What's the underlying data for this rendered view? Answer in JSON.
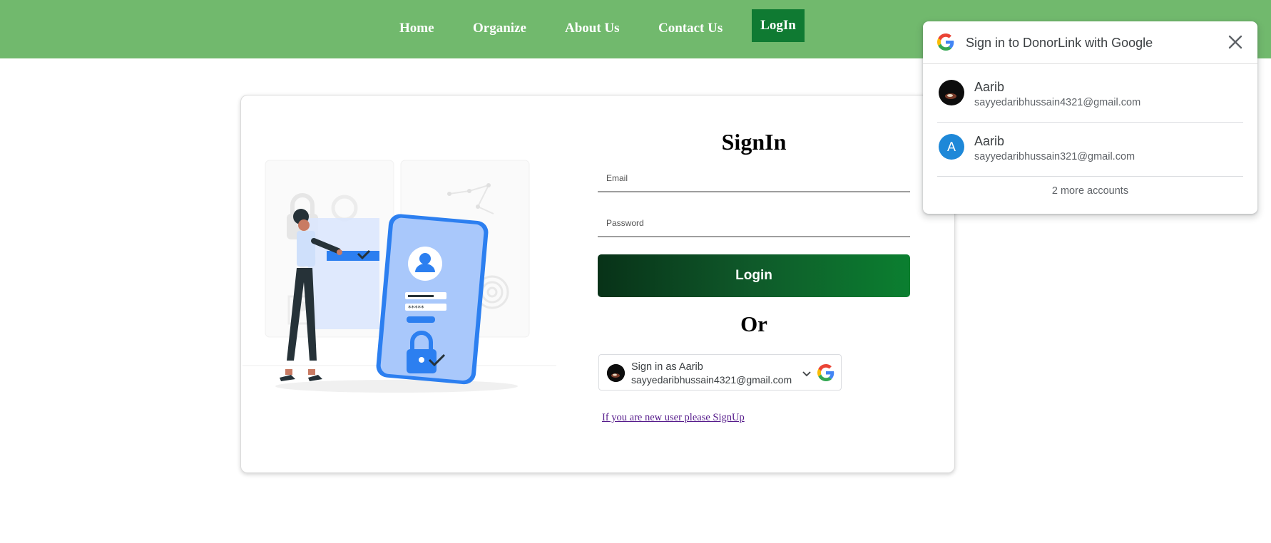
{
  "navbar": {
    "items": [
      {
        "label": "Home"
      },
      {
        "label": "Organize"
      },
      {
        "label": "About Us"
      },
      {
        "label": "Contact Us"
      }
    ],
    "login_label": "LogIn",
    "bg_color": "#71b96d",
    "login_color": "#0f7a32"
  },
  "form": {
    "title": "SignIn",
    "email_placeholder": "Email",
    "email_value": "",
    "password_placeholder": "Password",
    "password_value": "",
    "login_label": "Login",
    "or_label": "Or",
    "google_button": {
      "line1": "Sign in as Aarib",
      "line2": "sayyedaribhussain4321@gmail.com"
    },
    "signup_link": "If you are new user please SignUp"
  },
  "google_popup": {
    "title": "Sign in to DonorLink with Google",
    "accounts": [
      {
        "name": "Aarib",
        "email": "sayyedaribhussain4321@gmail.com",
        "avatar": "photo"
      },
      {
        "name": "Aarib",
        "email": "sayyedaribhussain321@gmail.com",
        "avatar": "A",
        "avatar_color": "#1e88d8"
      }
    ],
    "more_label": "2 more accounts"
  },
  "icons": [
    "google-logo-icon",
    "close-icon",
    "chevron-down-icon"
  ]
}
